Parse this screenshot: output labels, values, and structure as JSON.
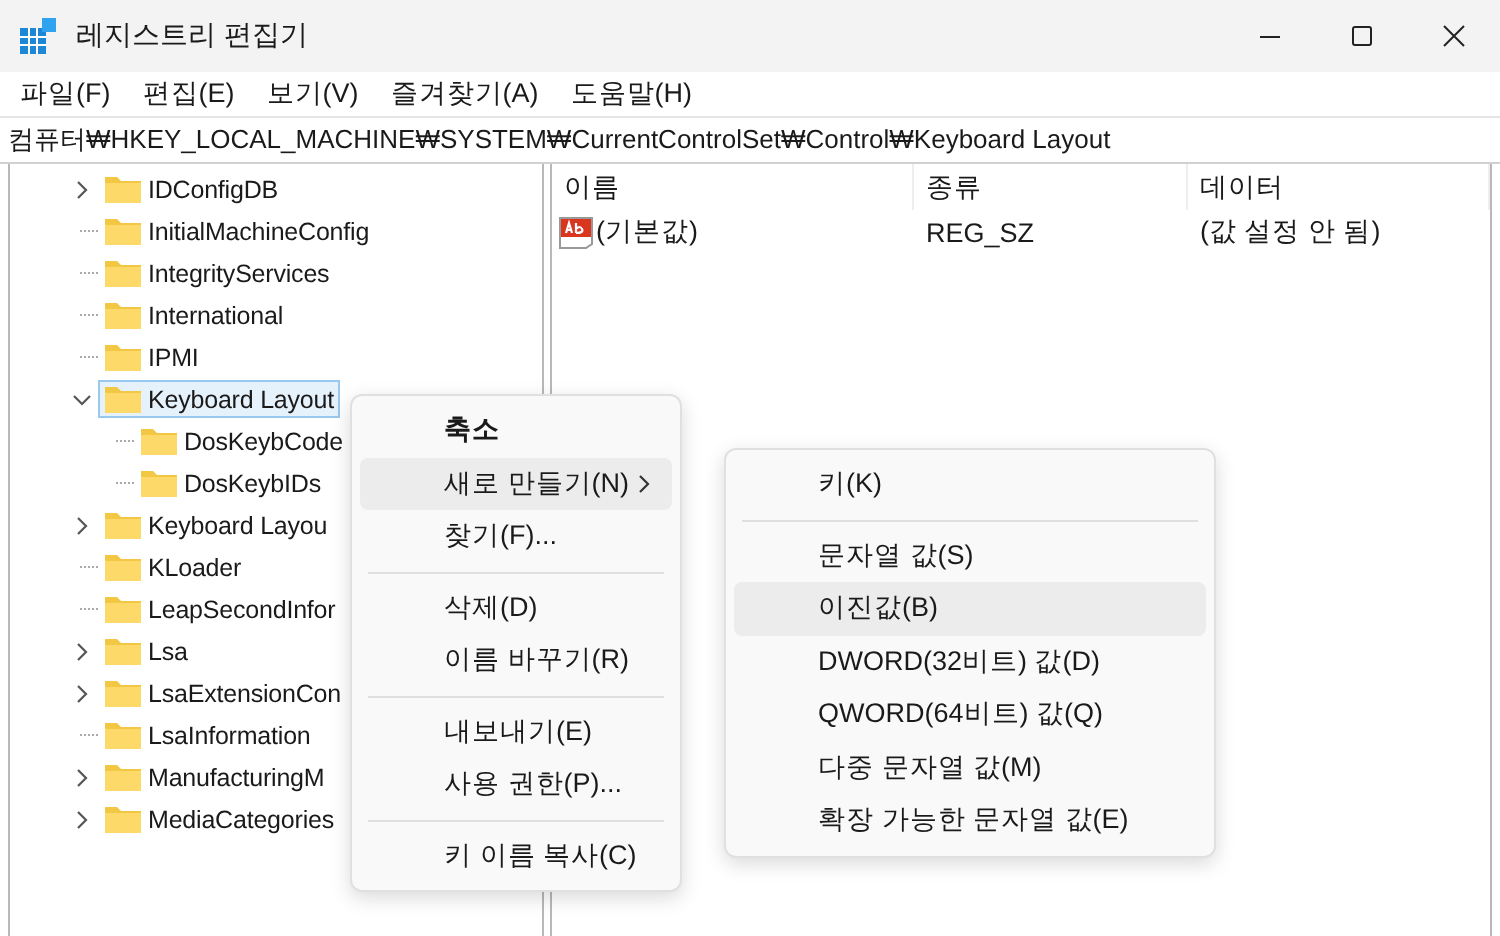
{
  "window": {
    "title": "레지스트리 편집기"
  },
  "menu_bar": [
    "파일(F)",
    "편집(E)",
    "보기(V)",
    "즐겨찾기(A)",
    "도움말(H)"
  ],
  "address": "컴퓨터₩HKEY_LOCAL_MACHINE₩SYSTEM₩CurrentControlSet₩Control₩Keyboard Layout",
  "tree": [
    {
      "label": "IDConfigDB",
      "expanded": false,
      "selected": false
    },
    {
      "label": "InitialMachineConfig",
      "selected": false
    },
    {
      "label": "IntegrityServices",
      "selected": false
    },
    {
      "label": "International",
      "selected": false
    },
    {
      "label": "IPMI",
      "selected": false
    },
    {
      "label": "Keyboard Layout",
      "expanded": true,
      "selected": true,
      "children": [
        {
          "label": "DosKeybCode",
          "selected": false
        },
        {
          "label": "DosKeybIDs",
          "selected": false
        }
      ]
    },
    {
      "label": "Keyboard Layou",
      "expanded": false,
      "selected": false
    },
    {
      "label": "KLoader",
      "selected": false
    },
    {
      "label": "LeapSecondInfor",
      "selected": false
    },
    {
      "label": "Lsa",
      "expanded": false,
      "selected": false
    },
    {
      "label": "LsaExtensionCon",
      "expanded": false,
      "selected": false
    },
    {
      "label": "LsaInformation",
      "selected": false
    },
    {
      "label": "ManufacturingM",
      "expanded": false,
      "selected": false
    },
    {
      "label": "MediaCategories",
      "expanded": false,
      "selected": false
    }
  ],
  "values_table": {
    "columns": [
      "이름",
      "종류",
      "데이터"
    ],
    "rows": [
      {
        "name": "(기본값)",
        "type": "REG_SZ",
        "data": "(값 설정 안 됨)"
      }
    ]
  },
  "context_menu": {
    "items": [
      {
        "kind": "item",
        "label": "축소",
        "bold": true,
        "highlighted": false
      },
      {
        "kind": "submenu",
        "label": "새로 만들기(N)",
        "highlighted": true
      },
      {
        "kind": "item",
        "label": "찾기(F)...",
        "highlighted": false
      },
      {
        "kind": "separator"
      },
      {
        "kind": "item",
        "label": "삭제(D)",
        "highlighted": false
      },
      {
        "kind": "item",
        "label": "이름 바꾸기(R)",
        "highlighted": false
      },
      {
        "kind": "separator"
      },
      {
        "kind": "item",
        "label": "내보내기(E)",
        "highlighted": false
      },
      {
        "kind": "item",
        "label": "사용 권한(P)...",
        "highlighted": false
      },
      {
        "kind": "separator"
      },
      {
        "kind": "item",
        "label": "키 이름 복사(C)",
        "highlighted": false
      }
    ]
  },
  "submenu": {
    "items": [
      {
        "kind": "item",
        "label": "키(K)",
        "highlighted": false
      },
      {
        "kind": "separator"
      },
      {
        "kind": "item",
        "label": "문자열 값(S)",
        "highlighted": false
      },
      {
        "kind": "item",
        "label": "이진값(B)",
        "highlighted": true
      },
      {
        "kind": "item",
        "label": "DWORD(32비트) 값(D)",
        "highlighted": false
      },
      {
        "kind": "item",
        "label": "QWORD(64비트) 값(Q)",
        "highlighted": false
      },
      {
        "kind": "item",
        "label": "다중 문자열 값(M)",
        "highlighted": false
      },
      {
        "kind": "item",
        "label": "확장 가능한 문자열 값(E)",
        "highlighted": false
      }
    ]
  }
}
